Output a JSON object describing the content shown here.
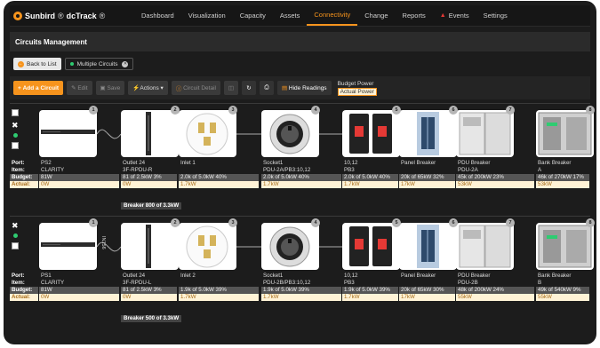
{
  "app": {
    "brand": "Sunbird",
    "product": "dcTrack"
  },
  "nav": [
    "Dashboard",
    "Visualization",
    "Capacity",
    "Assets",
    "Connectivity",
    "Change",
    "Reports",
    "Events",
    "Settings"
  ],
  "active_nav": "Connectivity",
  "page_title": "Circuits Management",
  "tabs": {
    "back": "Back to List",
    "multiple": "Multiple Circuits"
  },
  "toolbar": {
    "add": "Add a Circuit",
    "edit": "Edit",
    "save": "Save",
    "actions": "Actions",
    "detail": "Circuit Detail",
    "hide": "Hide Readings",
    "budget_power": "Budget Power",
    "actual_power": "Actual Power"
  },
  "row_labels": {
    "port": "Port:",
    "item": "Item:",
    "budget": "Budget:",
    "actual": "Actual:"
  },
  "circuits": [
    {
      "source": {
        "port": "PS2",
        "item": "CLARITY",
        "budget": "81W",
        "actual": "0W"
      },
      "outlet": {
        "port": "Outlet 24",
        "item": "3F-RPDU-R",
        "budget": "81 of 2.5kW  3%",
        "actual": "0W"
      },
      "inlet": {
        "port": "Inlet 1",
        "item": "",
        "budget": "2.0k of 5.0kW  40%",
        "actual": "1.7kW"
      },
      "socket": {
        "port": "Socket1",
        "item": "PDU-2A/PB3:10,12",
        "budget": "2.0k of 5.0kW  40%",
        "actual": "1.7kW"
      },
      "breaker": {
        "port": "10,12",
        "item": "PB3",
        "budget": "2.0k of 5.0kW  40%",
        "actual": "1.7kW"
      },
      "panel": {
        "port": "Panel Breaker",
        "item": "",
        "budget": "20k of 65kW  32%",
        "actual": "17kW"
      },
      "pdu": {
        "port": "PDU Breaker",
        "item": "PDU-2A",
        "budget": "45k of 200kW  23%",
        "actual": "53kW"
      },
      "bank": {
        "port": "Bank Breaker",
        "item": "A",
        "budget": "46k of 270kW  17%",
        "actual": "53kW"
      },
      "breaker_note": "Breaker 800 of 3.3kW",
      "cable_label": ""
    },
    {
      "source": {
        "port": "PS1",
        "item": "CLARITY",
        "budget": "81W",
        "actual": "0W"
      },
      "outlet": {
        "port": "Outlet 24",
        "item": "3F-RPDU-L",
        "budget": "81 of 2.5kW  3%",
        "actual": "0W"
      },
      "inlet": {
        "port": "Inlet 2",
        "item": "",
        "budget": "1.9k of 5.0kW  39%",
        "actual": "1.7kW"
      },
      "socket": {
        "port": "Socket1",
        "item": "PDU-2B/PB3:10,12",
        "budget": "1.9k of 5.0kW  39%",
        "actual": "1.7kW"
      },
      "breaker": {
        "port": "10,12",
        "item": "PB3",
        "budget": "1.9k of 5.0kW  39%",
        "actual": "1.7kW"
      },
      "panel": {
        "port": "Panel Breaker",
        "item": "",
        "budget": "20k of 65kW  30%",
        "actual": "17kW"
      },
      "pdu": {
        "port": "PDU Breaker",
        "item": "PDU-2B",
        "budget": "48k of 200kW  24%",
        "actual": "55kW"
      },
      "bank": {
        "port": "Bank Breaker",
        "item": "B",
        "budget": "49k of 540kW  9%",
        "actual": "55kW"
      },
      "breaker_note": "Breaker 500 of 3.3kW",
      "cable_label": "IN156"
    }
  ],
  "card_numbers": [
    "1",
    "2",
    "3",
    "4",
    "5",
    "6",
    "7",
    "8"
  ],
  "colors": {
    "accent": "#f7941d",
    "background": "#1c1c1c",
    "budget_bg": "#555555",
    "actual_bg": "#fff3d6"
  }
}
